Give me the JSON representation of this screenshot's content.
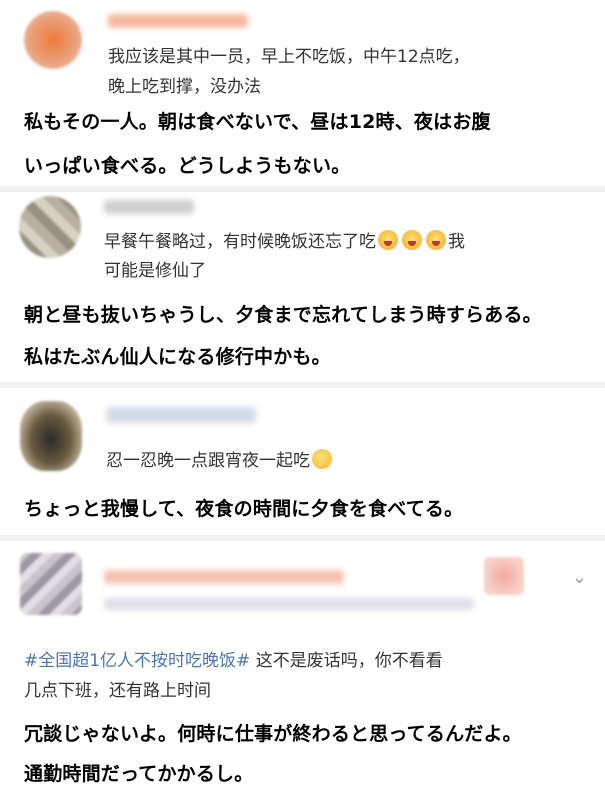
{
  "comments": [
    {
      "cn_lines": [
        "我应该是其中一员，早上不吃饭，中午12点吃，",
        "晚上吃到撑，没办法"
      ],
      "jp_lines": [
        "私もその一人。朝は食べないで、昼は12時、夜はお腹",
        "いっぱい食べる。どうしようもない。"
      ]
    },
    {
      "cn_lines": [
        "早餐午餐略过，有时候晚饭还忘了吃",
        "我",
        "可能是修仙了"
      ],
      "jp_lines": [
        "朝と昼も抜いちゃうし、夕食まで忘れてしまう時すらある。",
        "私はたぶん仙人になる修行中かも。"
      ]
    },
    {
      "cn_lines": [
        "忍一忍晚一点跟宵夜一起吃"
      ],
      "jp_lines": [
        "ちょっと我慢して、夜食の時間に夕食を食べてる。"
      ]
    },
    {
      "cn_hashtag": "#全国超1亿人不按时吃晚饭#",
      "cn_lines": [
        "这不是废话吗，你不看看",
        "几点下班，还有路上时间"
      ],
      "jp_lines": [
        "冗談じゃないよ。何時に仕事が終わると思ってるんだよ。",
        "通勤時間だってかかるし。"
      ]
    }
  ],
  "icons": {
    "emoji": "scared-face-icon",
    "thinking": "thinking-face-icon",
    "chevron": "chevron-down-icon"
  },
  "colors": {
    "hashtag": "#4a76b5",
    "separator": "#f1f1f1"
  }
}
